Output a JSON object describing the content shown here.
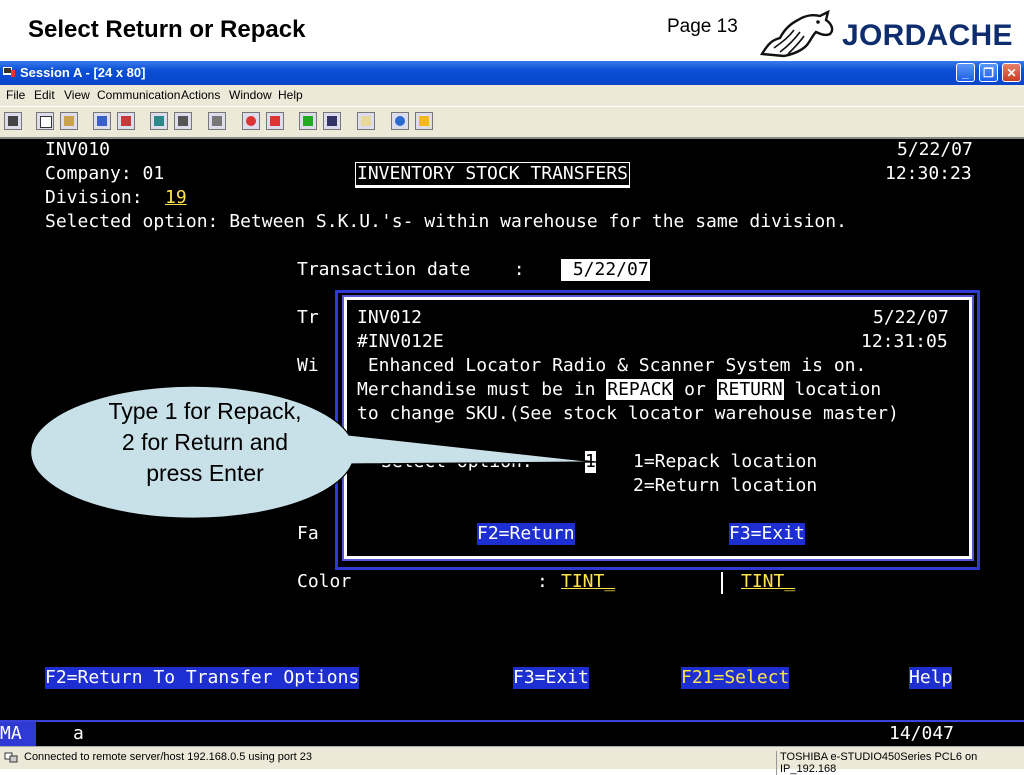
{
  "slide": {
    "title": "Select Return or Repack",
    "page": "Page 13",
    "logo_text": "JORDACHE"
  },
  "window": {
    "title": "Session A - [24 x 80]",
    "buttons": {
      "minimize": "_",
      "restore": "❐",
      "close": "✕"
    },
    "menu": [
      "File",
      "Edit",
      "View",
      "Communication",
      "Actions",
      "Window",
      "Help"
    ]
  },
  "terminal": {
    "program": "INV010",
    "date": "5/22/07",
    "company_line": "Company: 01",
    "screen_title": "INVENTORY STOCK TRANSFERS",
    "time": "12:30:23",
    "division_label": "Division:",
    "division_value": "19",
    "selected_option": "Selected option: Between S.K.U.'s- within warehouse for the same division.",
    "transaction_date_label": "Transaction date    :",
    "transaction_date_value": " 5/22/07",
    "row_tr": "Tr",
    "row_wi": "Wi",
    "row_fa": "Fa",
    "color_label": "Color",
    "color_sep": ":",
    "color_from": "TINT_",
    "color_to": "TINT_",
    "fkeys": {
      "f2": "F2=Return To Transfer Options",
      "f3": "F3=Exit",
      "f21": "F21=Select",
      "help": "Help"
    }
  },
  "popup": {
    "program": "INV012",
    "date": "5/22/07",
    "format": "#INV012E",
    "time": "12:31:05",
    "line1": " Enhanced Locator Radio & Scanner System is on.",
    "line2_prefix": "Merchandise must be in ",
    "repack": "REPACK",
    "line2_or": " or ",
    "return": "RETURN",
    "line2_suffix": " location",
    "line3": "to change SKU.(See stock locator warehouse master)",
    "select_label": "Select option:",
    "select_value": "1",
    "opt1": "1=Repack location",
    "opt2": "2=Return location",
    "f2": "F2=Return",
    "f3": "F3=Exit"
  },
  "oia": {
    "mode": "MA",
    "input": "a",
    "position": "14/047"
  },
  "status": {
    "connection": "Connected to remote server/host 192.168.0.5 using port 23",
    "printer": "TOSHIBA e-STUDIO450Series PCL6 on IP_192.168"
  },
  "callout": {
    "line1": "Type 1 for Repack,",
    "line2": "2 for Return and",
    "line3": "press Enter"
  }
}
